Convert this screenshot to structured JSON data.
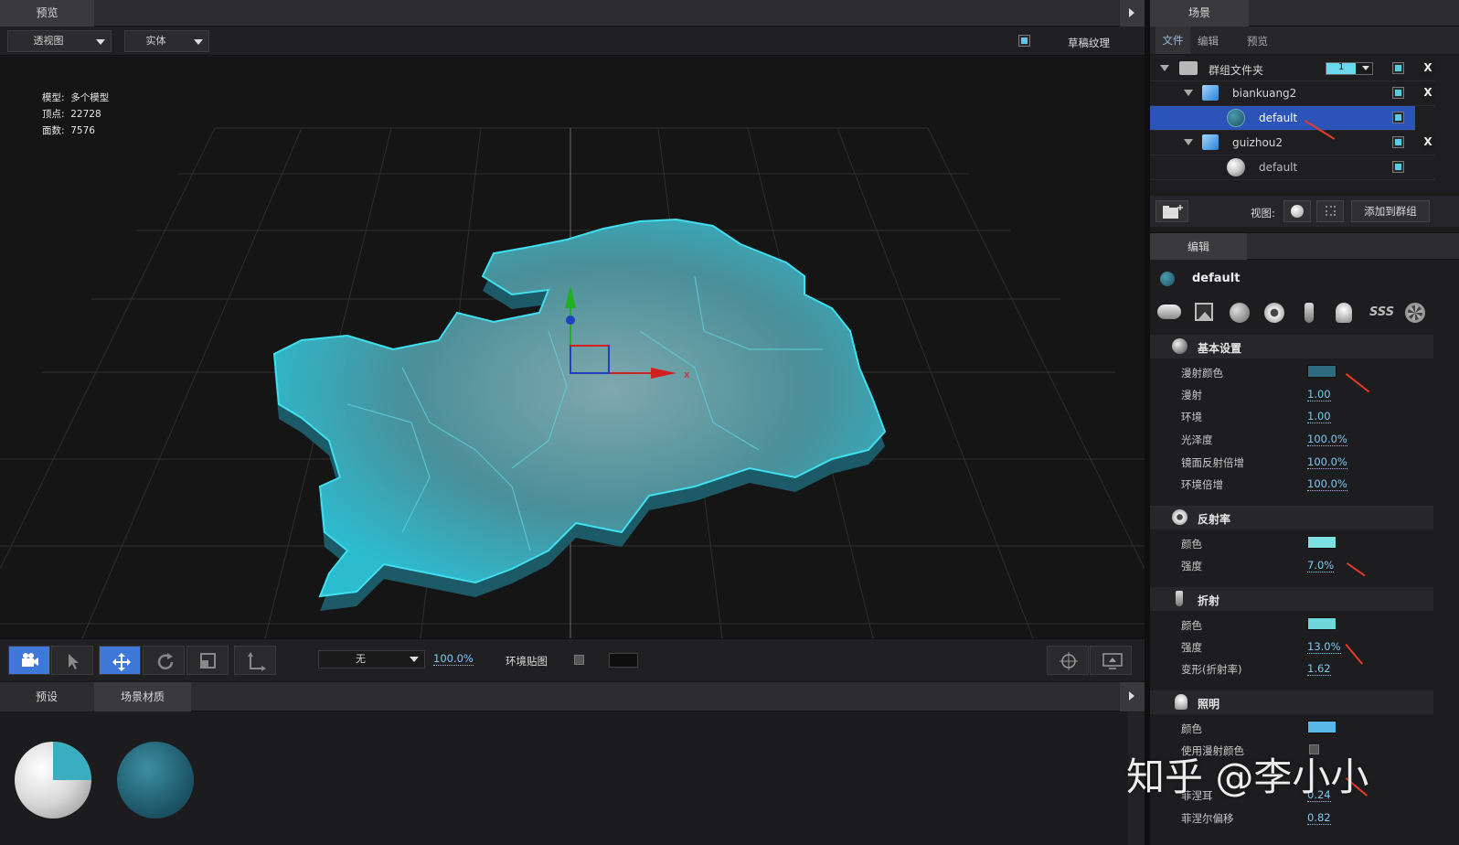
{
  "preview_tab": {
    "label": "预览"
  },
  "viewport_toolbar": {
    "view_dropdown": "透视图",
    "shade_dropdown": "实体",
    "draft_texture_label": "草稿纹理"
  },
  "stats": {
    "model_label": "模型:",
    "model_value": "多个模型",
    "verts_label": "顶点:",
    "verts_value": "22728",
    "faces_label": "面数:",
    "faces_value": "7576"
  },
  "bottom_toolbar": {
    "env_select": "无",
    "env_percent": "100.0%",
    "env_map_label": "环境贴图"
  },
  "bottom_panel": {
    "tabs": [
      "预设",
      "场景材质"
    ]
  },
  "scene_panel": {
    "title": "场景",
    "tabs": [
      "文件",
      "编辑",
      "预览"
    ],
    "tree": [
      {
        "label": "群组文件夹",
        "badge": "1"
      },
      {
        "label": "biankuang2"
      },
      {
        "label": "default"
      },
      {
        "label": "guizhou2"
      },
      {
        "label": "default"
      }
    ],
    "view_label": "视图:",
    "add_group_label": "添加到群组"
  },
  "edit_panel": {
    "title": "编辑",
    "material_name": "default",
    "icon_row": [
      "material-type-icon",
      "texture-icon",
      "sphere-icon",
      "reflection-icon",
      "refraction-icon",
      "light-icon",
      "sss-icon",
      "misc-icon"
    ],
    "sss_label": "SSS",
    "sections": {
      "basic": {
        "title": "基本设置",
        "diffuse_color_label": "漫射颜色",
        "diffuse_color": "#2e6a80",
        "diffuse_label": "漫射",
        "diffuse_value": "1.00",
        "ambient_label": "环境",
        "ambient_value": "1.00",
        "gloss_label": "光泽度",
        "gloss_value": "100.0%",
        "spec_mult_label": "镜面反射倍增",
        "spec_mult_value": "100.0%",
        "amb_mult_label": "环境倍增",
        "amb_mult_value": "100.0%"
      },
      "reflect": {
        "title": "反射率",
        "color_label": "颜色",
        "color": "#7fe0e4",
        "strength_label": "强度",
        "strength_value": "7.0%"
      },
      "refract": {
        "title": "折射",
        "color_label": "颜色",
        "color": "#6fd6dc",
        "strength_label": "强度",
        "strength_value": "13.0%",
        "ior_label": "变形(折射率)",
        "ior_value": "1.62"
      },
      "illum": {
        "title": "照明",
        "color_label": "颜色",
        "color": "#5ab8e8",
        "use_diffuse_label": "使用漫射颜色",
        "fresnel_label": "菲涅耳",
        "fresnel_value": "0.24",
        "fresnel_offset_label": "菲涅尔偏移",
        "fresnel_offset_value": "0.82"
      }
    }
  },
  "watermark": "知乎 @李小小"
}
